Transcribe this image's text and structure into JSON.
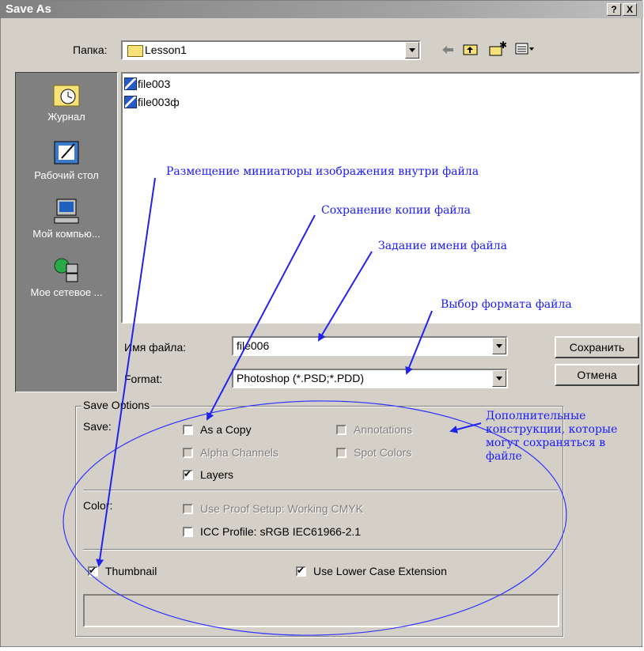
{
  "window": {
    "title": "Save As",
    "help_btn": "?",
    "close_btn": "X"
  },
  "folder": {
    "label": "Папка:",
    "value": "Lesson1"
  },
  "places": [
    {
      "label": "Журнал",
      "icon": "history-icon"
    },
    {
      "label": "Рабочий стол",
      "icon": "desktop-icon"
    },
    {
      "label": "Мой компью...",
      "icon": "my-computer-icon"
    },
    {
      "label": "Мое сетевое ...",
      "icon": "network-places-icon"
    }
  ],
  "files": [
    "file003",
    "file003ф"
  ],
  "filename": {
    "label": "Имя файла:",
    "value": "file006"
  },
  "format": {
    "label": "Format:",
    "value": "Photoshop (*.PSD;*.PDD)"
  },
  "buttons": {
    "save": "Сохранить",
    "cancel": "Отмена"
  },
  "options": {
    "group_title": "Save Options",
    "save_label": "Save:",
    "as_copy": "As a Copy",
    "annotations": "Annotations",
    "alpha_channels": "Alpha Channels",
    "spot_colors": "Spot Colors",
    "layers": "Layers",
    "color_label": "Color:",
    "use_proof": "Use Proof Setup:  Working CMYK",
    "icc_profile": "ICC Profile:  sRGB IEC61966-2.1",
    "thumbnail": "Thumbnail",
    "lower_case": "Use Lower Case Extension"
  },
  "annotations": {
    "thumbnail_note": "Размещение миниатюры изображения внутри файла",
    "copy_note": "Сохранение копии файла",
    "name_note": "Задание имени файла",
    "format_note": "Выбор формата файла",
    "extra_note": "Дополнительные конструкции, которые могут сохраняться в файле"
  },
  "colors": {
    "annotation": "#1a1aff",
    "dialog": "#d4d0c8"
  }
}
